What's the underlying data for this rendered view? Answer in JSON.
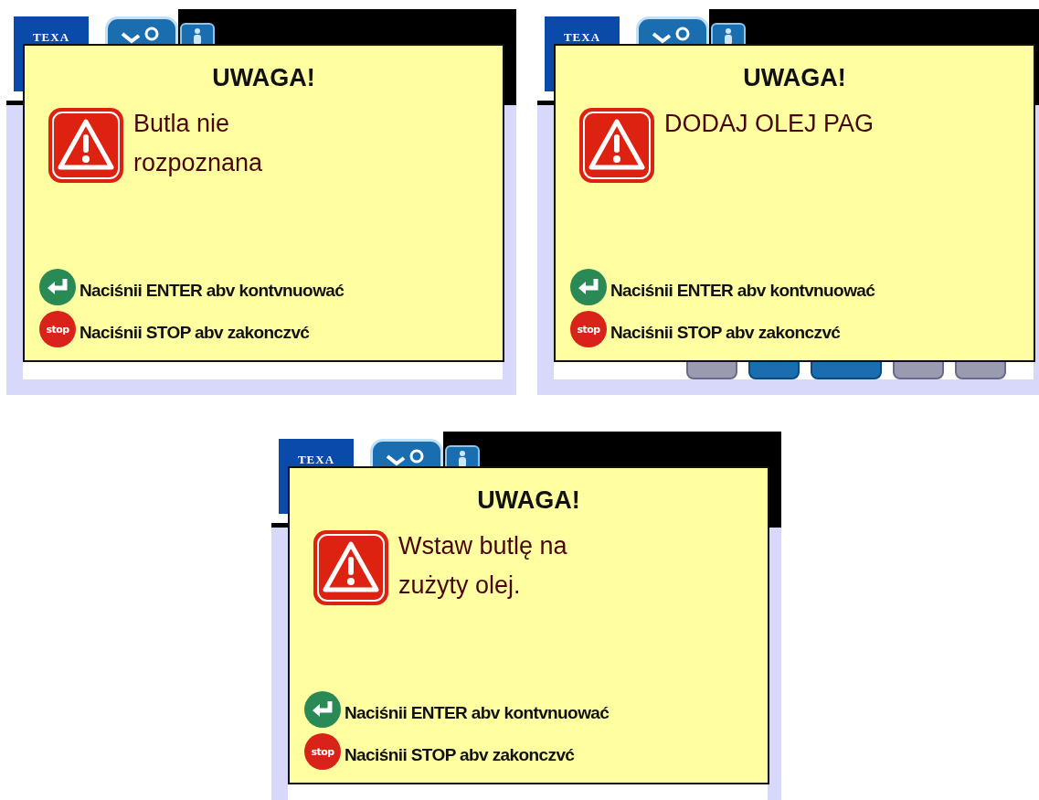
{
  "screens": [
    {
      "logo": "TEXA",
      "title": "UWAGA!",
      "message_lines": [
        "Butla nie",
        "rozpoznana"
      ],
      "prompts": [
        {
          "kind": "enter",
          "text": "Naciśnii ENTER abv kontvnuować"
        },
        {
          "kind": "stop",
          "label": "stop",
          "text": "Naciśnii STOP abv zakonczvć"
        }
      ]
    },
    {
      "logo": "TEXA",
      "title": "UWAGA!",
      "message_lines": [
        "DODAJ OLEJ PAG"
      ],
      "prompts": [
        {
          "kind": "enter",
          "text": "Naciśnii ENTER abv kontvnuować"
        },
        {
          "kind": "stop",
          "label": "stop",
          "text": "Naciśnii STOP abv zakonczvć"
        }
      ],
      "toolbar": [
        {
          "disabled": true
        },
        {
          "disabled": false
        },
        {
          "disabled": false
        },
        {
          "disabled": true
        },
        {
          "disabled": true
        }
      ]
    },
    {
      "logo": "TEXA",
      "title": "UWAGA!",
      "message_lines": [
        "Wstaw butlę na",
        "zużyty olej."
      ],
      "prompts": [
        {
          "kind": "enter",
          "text": "Naciśnii ENTER abv kontvnuować"
        },
        {
          "kind": "stop",
          "label": "stop",
          "text": "Naciśnii STOP abv zakonczvć"
        }
      ]
    }
  ]
}
